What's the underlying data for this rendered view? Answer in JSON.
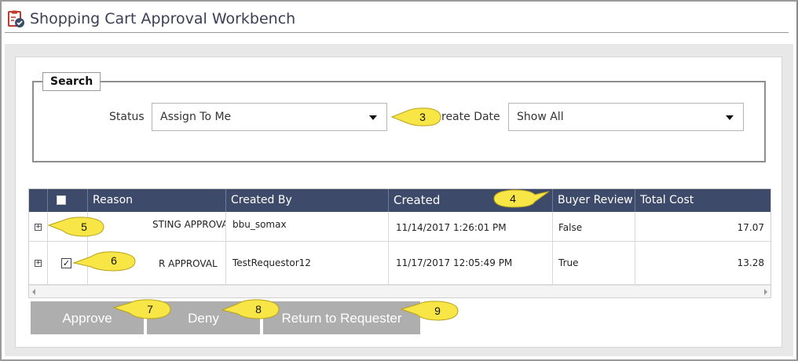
{
  "app": {
    "title": "Shopping Cart Approval Workbench",
    "icon": "clipboard-check-icon"
  },
  "search": {
    "legend": "Search",
    "status_label": "Status",
    "status_value": "Assign To Me",
    "create_date_label": "Create Date",
    "create_date_visible_label": "reate Date",
    "create_date_value": "Show All"
  },
  "table": {
    "columns": [
      "",
      "",
      "Reason",
      "Created By",
      "Created",
      "Buyer Review",
      "Total Cost"
    ],
    "rows": [
      {
        "checked": false,
        "reason": "STING APPROVALS",
        "created_by": "bbu_somax",
        "created": "11/14/2017 1:26:01 PM",
        "buyer_review": "False",
        "total_cost": "17.07"
      },
      {
        "checked": true,
        "reason": "R APPROVAL",
        "created_by": "TestRequestor12",
        "created": "11/17/2017 12:05:49 PM",
        "buyer_review": "True",
        "total_cost": "13.28"
      }
    ]
  },
  "buttons": {
    "approve": "Approve",
    "deny": "Deny",
    "return": "Return to Requester"
  },
  "callouts": [
    "3",
    "4",
    "5",
    "6",
    "7",
    "8",
    "9"
  ],
  "colors": {
    "header_bg": "#3d4a69",
    "button_bg": "#aeaeae",
    "callout_fill": "#f7e646"
  }
}
